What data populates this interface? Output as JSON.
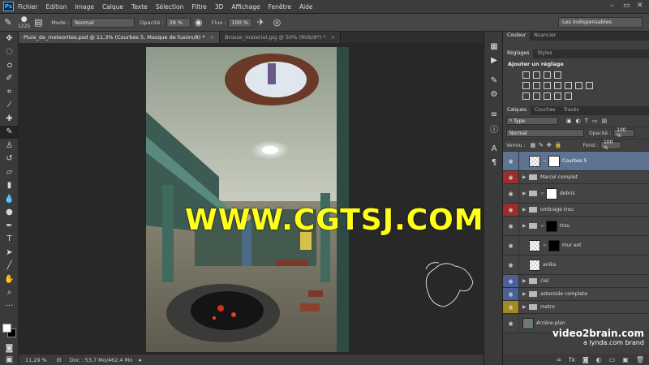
{
  "menubar": {
    "logo": "Ps",
    "items": [
      "Fichier",
      "Edition",
      "Image",
      "Calque",
      "Texte",
      "Sélection",
      "Filtre",
      "3D",
      "Affichage",
      "Fenêtre",
      "Aide"
    ]
  },
  "options": {
    "brush_size": "1225",
    "mode_label": "Mode :",
    "mode_value": "Normal",
    "opacity_label": "Opacité :",
    "opacity_value": "28 %",
    "flow_label": "Flux :",
    "flow_value": "100 %",
    "workspace": "Les indispensables"
  },
  "tabs": [
    {
      "label": "Pluie_de_meteorites.psd @ 11,3% (Courbes 5, Masque de fusion/8) *",
      "active": true
    },
    {
      "label": "Brosse_material.jpg @ 50% (RVB/8*) *",
      "active": false
    }
  ],
  "canvas": {
    "watermark": "WWW.CGTSJ.COM"
  },
  "status": {
    "zoom": "11,29 %",
    "doc": "Doc : 53,7 Mo/462,4 Mo"
  },
  "panels": {
    "color_tabs": [
      "Couleur",
      "Nuancier"
    ],
    "adjust_tabs": [
      "Réglages",
      "Styles"
    ],
    "adjust_title": "Ajouter un réglage",
    "layer_tabs": [
      "Calques",
      "Couches",
      "Tracés"
    ],
    "filter_kind": "Type",
    "blend_mode": "Normal",
    "opacity_label": "Opacité :",
    "opacity_value": "100 %",
    "lock_label": "Verrou :",
    "fill_label": "Fond :",
    "fill_value": "100 %",
    "layers": [
      {
        "name": "Courbes 5",
        "selected": true,
        "eye_color": "",
        "kind": "adjust"
      },
      {
        "name": "Marcel complet",
        "selected": false,
        "eye_color": "red",
        "kind": "group"
      },
      {
        "name": "debris",
        "selected": false,
        "eye_color": "",
        "kind": "group-mask"
      },
      {
        "name": "ombrage trou",
        "selected": false,
        "eye_color": "red",
        "kind": "group"
      },
      {
        "name": "trou",
        "selected": false,
        "eye_color": "",
        "kind": "group-mask-dark"
      },
      {
        "name": "mur ext",
        "selected": false,
        "eye_color": "",
        "kind": "pixel-mask"
      },
      {
        "name": "anika",
        "selected": false,
        "eye_color": "",
        "kind": "pixel"
      },
      {
        "name": "ciel",
        "selected": false,
        "eye_color": "blue",
        "kind": "group"
      },
      {
        "name": "asteroide complete",
        "selected": false,
        "eye_color": "blue",
        "kind": "group"
      },
      {
        "name": "metro",
        "selected": false,
        "eye_color": "yellow",
        "kind": "group"
      },
      {
        "name": "Arrière-plan",
        "selected": false,
        "eye_color": "",
        "kind": "background"
      }
    ]
  },
  "brand": {
    "line1": "video2brain.com",
    "line2": "a lynda.com brand"
  }
}
